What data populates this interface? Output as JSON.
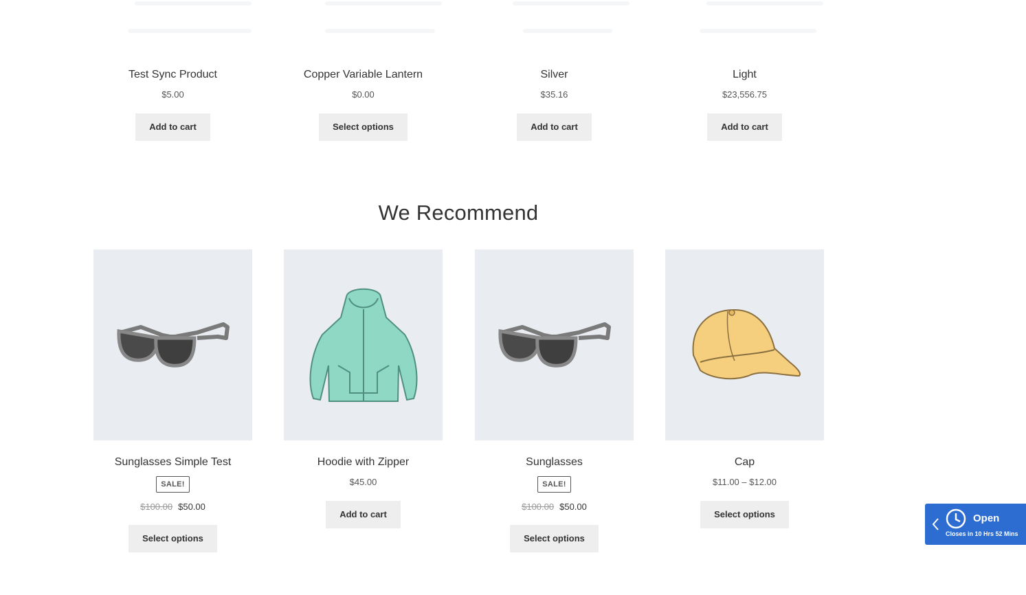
{
  "top_products": [
    {
      "title": "Test Sync Product",
      "price": "$5.00",
      "button": "Add to cart"
    },
    {
      "title": "Copper Variable Lantern",
      "price": "$0.00",
      "button": "Select options"
    },
    {
      "title": "Silver",
      "price": "$35.16",
      "button": "Add to cart"
    },
    {
      "title": "Light",
      "price": "$23,556.75",
      "button": "Add to cart"
    }
  ],
  "recommend": {
    "heading": "We Recommend",
    "products": [
      {
        "title": "Sunglasses Simple Test",
        "badge": "SALE!",
        "old_price": "$100.00",
        "price": "$50.00",
        "button": "Select options",
        "image_icon": "sunglasses-image"
      },
      {
        "title": "Hoodie with Zipper",
        "price": "$45.00",
        "button": "Add to cart",
        "image_icon": "hoodie-image"
      },
      {
        "title": "Sunglasses",
        "badge": "SALE!",
        "old_price": "$100.00",
        "price": "$50.00",
        "button": "Select options",
        "image_icon": "sunglasses-image"
      },
      {
        "title": "Cap",
        "price": "$11.00 – $12.00",
        "button": "Select options",
        "image_icon": "cap-image"
      }
    ]
  },
  "hours_widget": {
    "status": "Open",
    "subtext": "Closes in 10 Hrs 52 Mins",
    "color": "#2d6cd1"
  }
}
